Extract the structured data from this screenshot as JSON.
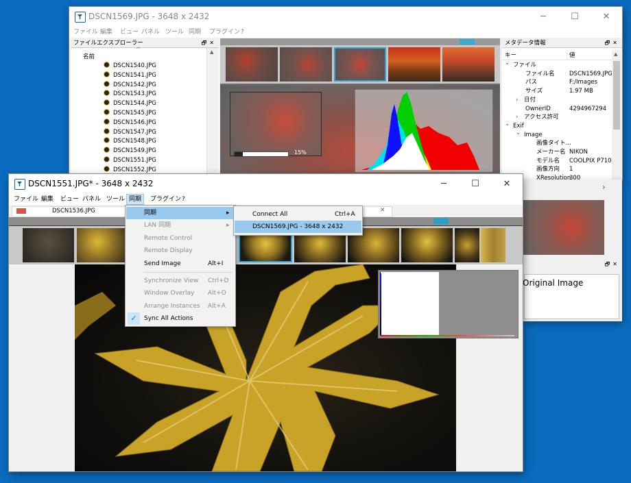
{
  "back_window": {
    "title": "DSCN1569.JPG - 3648 x 2432",
    "menu": [
      "ファイル",
      "編集",
      "ビュー",
      "パネル",
      "ツール",
      "同期",
      "プラグイン",
      "?"
    ],
    "explorer": {
      "title": "ファイルエクスプローラー",
      "column": "名前",
      "files": [
        "DSCN1540.JPG",
        "DSCN1541.JPG",
        "DSCN1542.JPG",
        "DSCN1543.JPG",
        "DSCN1544.JPG",
        "DSCN1545.JPG",
        "DSCN1546.JPG",
        "DSCN1547.JPG",
        "DSCN1548.JPG",
        "DSCN1549.JPG",
        "DSCN1551.JPG",
        "DSCN1552.JPG"
      ]
    },
    "progress": {
      "label": "15%",
      "value": 0.15
    },
    "metadata": {
      "title": "メタデータ情報",
      "col_key": "キー",
      "col_value": "値",
      "rows": [
        {
          "key": "ファイル",
          "value": "",
          "level": 0,
          "expander": "open"
        },
        {
          "key": "ファイル名",
          "value": "DSCN1569.JPG",
          "level": 2,
          "expander": ""
        },
        {
          "key": "パス",
          "value": "F:/Images",
          "level": 2,
          "expander": ""
        },
        {
          "key": "サイズ",
          "value": "1.97 MB",
          "level": 2,
          "expander": ""
        },
        {
          "key": "日付",
          "value": "",
          "level": 1,
          "expander": "closed"
        },
        {
          "key": "OwnerID",
          "value": "4294967294",
          "level": 2,
          "expander": ""
        },
        {
          "key": "アクセス許可",
          "value": "",
          "level": 1,
          "expander": "closed"
        },
        {
          "key": "Exif",
          "value": "",
          "level": 0,
          "expander": "open"
        },
        {
          "key": "Image",
          "value": "",
          "level": 1,
          "expander": "open"
        },
        {
          "key": "画像タイト…",
          "value": "",
          "level": 3,
          "expander": ""
        },
        {
          "key": "メーカー名",
          "value": "NIKON",
          "level": 3,
          "expander": ""
        },
        {
          "key": "モデル名",
          "value": "COOLPIX P710",
          "level": 3,
          "expander": ""
        },
        {
          "key": "画像方向",
          "value": "1",
          "level": 3,
          "expander": ""
        },
        {
          "key": "XResolution",
          "value": "300",
          "level": 3,
          "expander": ""
        }
      ]
    },
    "original_image_label": "Original Image"
  },
  "front_window": {
    "title": "DSCN1551.JPG* - 3648 x 2432",
    "menu": [
      "ファイル",
      "編集",
      "ビュー",
      "パネル",
      "ツール",
      "同期",
      "プラグイン",
      "?"
    ],
    "tab_label": "DSCN1536.JPG",
    "sync_menu": {
      "items": [
        {
          "label": "同期",
          "shortcut": "",
          "disabled": false,
          "submenu": true
        },
        {
          "label": "LAN 同期",
          "shortcut": "",
          "disabled": true,
          "submenu": true
        },
        {
          "label": "Remote Control",
          "shortcut": "",
          "disabled": true
        },
        {
          "label": "Remote Display",
          "shortcut": "",
          "disabled": true
        },
        {
          "label": "Send Image",
          "shortcut": "Alt+I",
          "disabled": false
        },
        {
          "label": "Synchronize View",
          "shortcut": "Ctrl+D",
          "disabled": true
        },
        {
          "label": "Window Overlay",
          "shortcut": "Alt+O",
          "disabled": true
        },
        {
          "label": "Arrange Instances",
          "shortcut": "Alt+A",
          "disabled": true
        },
        {
          "label": "Sync All Actions",
          "shortcut": "",
          "disabled": false,
          "checked": true
        }
      ],
      "submenu": {
        "items": [
          {
            "label": "Connect All",
            "shortcut": "Ctrl+A"
          },
          {
            "label": "DSCN1569.JPG  - 3648 x 2432",
            "shortcut": ""
          }
        ]
      }
    }
  },
  "icons": {
    "minimize": "─",
    "maximize": "☐",
    "close": "✕",
    "pin": "🗗",
    "check": "✓",
    "chevron_right": "›",
    "chevron_down": "⌄",
    "submenu_arrow": "▸",
    "sort_up": "^"
  },
  "colors": {
    "desktop": "#0a6bbf",
    "selection": "#99c9ef",
    "accent": "#0078d7"
  }
}
